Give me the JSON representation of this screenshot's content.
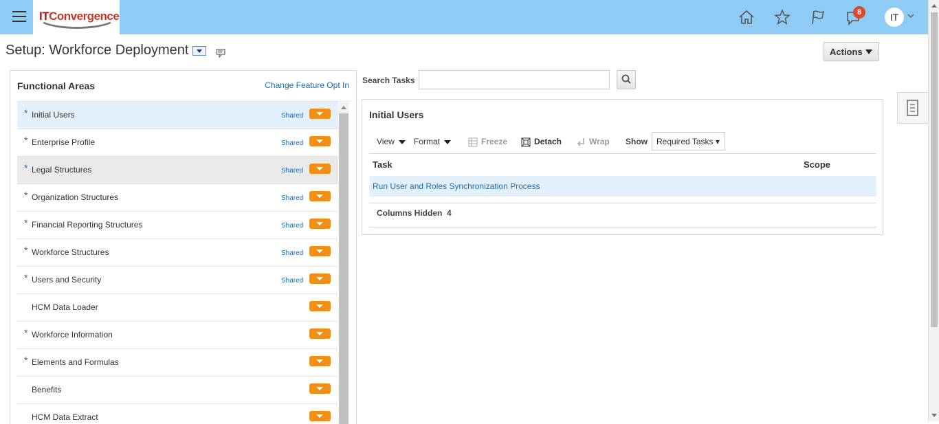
{
  "header": {
    "logo_it": "IT",
    "logo_rest": "Convergence",
    "notifications_count": "8",
    "user_initials": "IT",
    "bar_color": "#8ecbf5"
  },
  "page": {
    "title": "Setup: Workforce Deployment",
    "actions_label": "Actions"
  },
  "functional_areas": {
    "title": "Functional Areas",
    "change_link": "Change Feature Opt In",
    "items": [
      {
        "label": "Initial Users",
        "required": true,
        "shared": "Shared"
      },
      {
        "label": "Enterprise Profile",
        "required": true,
        "shared": "Shared"
      },
      {
        "label": "Legal Structures",
        "required": true,
        "shared": "Shared"
      },
      {
        "label": "Organization Structures",
        "required": true,
        "shared": "Shared"
      },
      {
        "label": "Financial Reporting Structures",
        "required": true,
        "shared": "Shared"
      },
      {
        "label": "Workforce Structures",
        "required": true,
        "shared": "Shared"
      },
      {
        "label": "Users and Security",
        "required": true,
        "shared": "Shared"
      },
      {
        "label": "HCM Data Loader",
        "required": false,
        "shared": ""
      },
      {
        "label": "Workforce Information",
        "required": true,
        "shared": ""
      },
      {
        "label": "Elements and Formulas",
        "required": true,
        "shared": ""
      },
      {
        "label": "Benefits",
        "required": false,
        "shared": ""
      },
      {
        "label": "HCM Data Extract",
        "required": false,
        "shared": ""
      }
    ]
  },
  "search": {
    "label": "Search Tasks",
    "value": ""
  },
  "tasks": {
    "title": "Initial Users",
    "toolbar": {
      "view": "View",
      "format": "Format",
      "freeze": "Freeze",
      "detach": "Detach",
      "wrap": "Wrap",
      "show": "Show",
      "show_value": "Required Tasks ▾"
    },
    "columns": {
      "task": "Task",
      "scope": "Scope"
    },
    "rows": [
      {
        "task": "Run User and Roles Synchronization Process",
        "scope": ""
      }
    ],
    "columns_hidden_label": "Columns Hidden",
    "columns_hidden_value": "4"
  }
}
